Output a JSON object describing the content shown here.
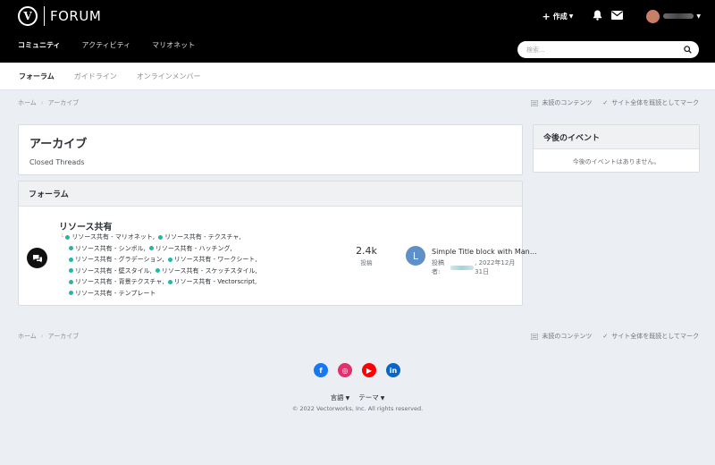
{
  "header": {
    "logo_text": "FORUM",
    "logo_letter": "V",
    "create_label": "作成",
    "nav": [
      "コミュニティ",
      "アクティビティ",
      "マリオネット"
    ],
    "search_placeholder": "検索..."
  },
  "subnav": [
    "フォーラム",
    "ガイドライン",
    "オンラインメンバー"
  ],
  "breadcrumb": {
    "home": "ホーム",
    "current": "アーカイブ",
    "unread": "未読のコンテンツ",
    "mark_read": "サイト全体を既読としてマーク"
  },
  "page": {
    "title": "アーカイブ",
    "subtitle": "Closed Threads"
  },
  "events": {
    "title": "今後のイベント",
    "empty": "今後のイベントはありません。"
  },
  "forum_section": {
    "title": "フォーラム",
    "forum": {
      "name": "リソース共有",
      "subforums": [
        "リソース共有 - マリオネット,",
        "リソース共有 - テクスチャ,",
        "リソース共有 - シンボル,",
        "リソース共有 - ハッチング,",
        "リソース共有 - グラデーション,",
        "リソース共有 - ワークシート,",
        "リソース共有 - 壁スタイル,",
        "リソース共有 - スケッチスタイル,",
        "リソース共有 - 背景テクスチャ,",
        "リソース共有 - Vectorscript,",
        "リソース共有 - テンプレート"
      ],
      "post_count": "2.4k",
      "post_label": "投稿",
      "last_post": {
        "avatar_letter": "L",
        "title": "Simple Title block with Manual Input",
        "by_label": "投稿者:",
        "date": ", 2022年12月31日"
      }
    }
  },
  "footer": {
    "social": [
      {
        "name": "facebook",
        "glyph": "f",
        "color": "#1877f2"
      },
      {
        "name": "instagram",
        "glyph": "◎",
        "color": "#e1306c"
      },
      {
        "name": "youtube",
        "glyph": "▶",
        "color": "#ff0000"
      },
      {
        "name": "linkedin",
        "glyph": "in",
        "color": "#0a66c2"
      }
    ],
    "language": "言語",
    "theme": "テーマ",
    "copyright": "© 2022 Vectorworks, Inc. All rights reserved."
  }
}
